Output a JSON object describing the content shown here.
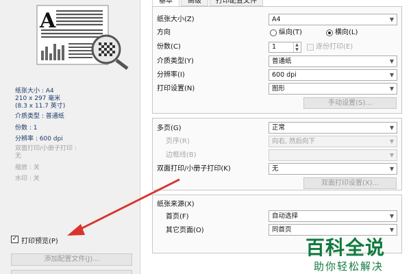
{
  "tabs": [
    {
      "label": "基本"
    },
    {
      "label": "高级"
    },
    {
      "label": "打印配置文件"
    }
  ],
  "summary": {
    "paper_size": "纸张大小 : A4",
    "dimensions": "210 x 297 毫米",
    "dimensions_in": "(8.3 x 11.7 英寸)",
    "media_type": "介质类型 : 普通纸",
    "copies": "份数 : 1",
    "resolution": "分辨率 : 600 dpi",
    "duplex": "双面打印/小册子打印 :",
    "duplex_val": "无",
    "scaling": "缩放 : 关",
    "watermark": "水印 : 关"
  },
  "preview_checkbox": {
    "label": "打印预览(P)",
    "checked": true
  },
  "add_profile_button": "添加配置文件(J)...",
  "form": {
    "paper_size": {
      "label": "纸张大小(Z)",
      "value": "A4"
    },
    "orientation": {
      "label": "方向",
      "portrait": "纵向(T)",
      "landscape": "横向(L)",
      "selected": "landscape"
    },
    "copies": {
      "label": "份数(C)",
      "value": "1",
      "collate": "逐份打印(E)"
    },
    "media_type": {
      "label": "介质类型(Y)",
      "value": "普通纸"
    },
    "resolution": {
      "label": "分辨率(I)",
      "value": "600 dpi"
    },
    "print_settings": {
      "label": "打印设置(N)",
      "value": "图形"
    },
    "manual_settings": "手动设置(S)...",
    "multiple_pages": {
      "label": "多页(G)",
      "value": "正常"
    },
    "page_order": {
      "label": "页序(R)",
      "value": "向右, 然后向下"
    },
    "border_line": {
      "label": "边框线(B)",
      "value": ""
    },
    "duplex": {
      "label": "双面打印/小册子打印(K)",
      "value": "无"
    },
    "duplex_settings": "双面打印设置(X)...",
    "paper_source": {
      "label": "纸张来源(X)"
    },
    "first_page": {
      "label": "首页(F)",
      "value": "自动选择"
    },
    "other_pages": {
      "label": "其它页面(O)",
      "value": "同首页"
    }
  },
  "watermark": {
    "line1": "百科全说",
    "line2": "助你轻松解决"
  },
  "colors": {
    "annotation_arrow": "#d9342b",
    "watermark": "#0f7a3e"
  }
}
